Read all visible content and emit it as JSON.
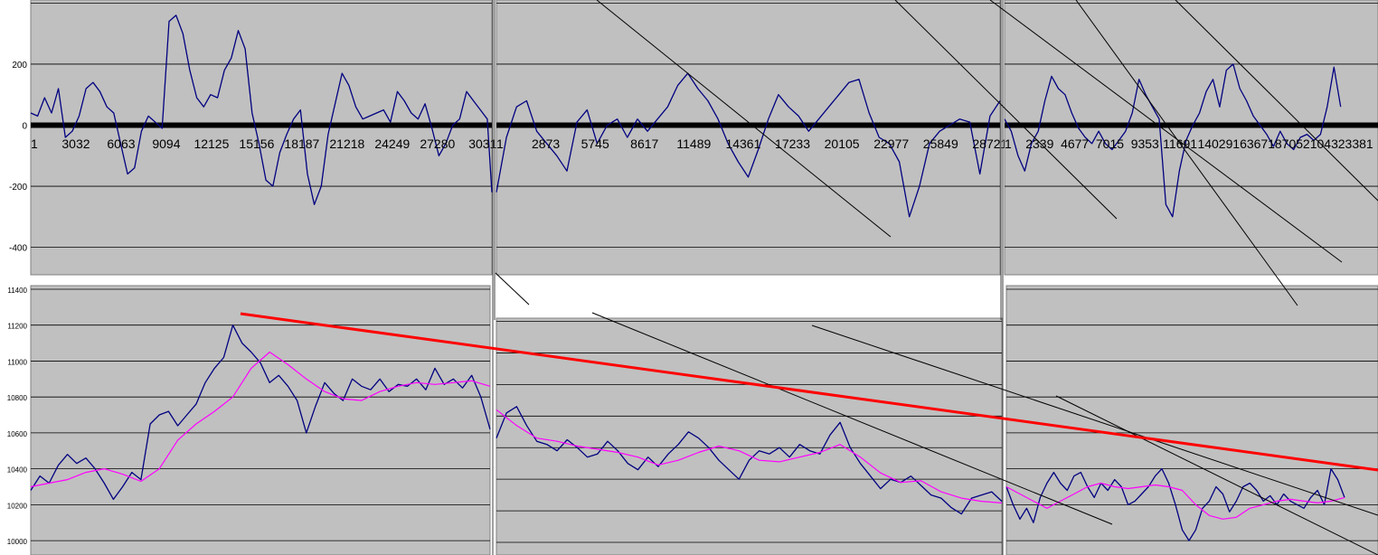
{
  "chart_data": [
    {
      "type": "line",
      "panel": "top-left",
      "y_ticks": [
        200,
        0,
        -200,
        -400
      ],
      "x_ticks": [
        "1",
        "3032",
        "6063",
        "9094",
        "12125",
        "15156",
        "18187",
        "21218",
        "24249",
        "27280",
        "3031"
      ],
      "ylim": [
        -490,
        410
      ],
      "series": [
        {
          "color": "#000080",
          "x": [
            0,
            1.5,
            3,
            4.5,
            6,
            7.5,
            9,
            10.5,
            12,
            13.5,
            15,
            16.5,
            18,
            19.5,
            21,
            22.5,
            24,
            25.5,
            27,
            28.5,
            30,
            31.5,
            33,
            34.5,
            36,
            37.5,
            39,
            40.5,
            42,
            43.5,
            45,
            46.5,
            48,
            49.5,
            51,
            52.5,
            54,
            55.5,
            57,
            58.5,
            60,
            61.5,
            63,
            64.5,
            66,
            67.5,
            69,
            70.5,
            72,
            73.5,
            75,
            76.5,
            78,
            79.5,
            81,
            82.5,
            84,
            85.5,
            87,
            88.5,
            90,
            91.5,
            93,
            94.5,
            96,
            97.5,
            99,
            100
          ],
          "y": [
            40,
            30,
            90,
            40,
            120,
            -40,
            -20,
            30,
            120,
            140,
            110,
            60,
            40,
            -60,
            -160,
            -140,
            -20,
            30,
            10,
            -10,
            340,
            360,
            300,
            180,
            90,
            60,
            100,
            90,
            180,
            220,
            310,
            250,
            40,
            -60,
            -180,
            -200,
            -90,
            -30,
            20,
            50,
            -160,
            -260,
            -200,
            -30,
            70,
            170,
            130,
            60,
            20,
            30,
            40,
            50,
            10,
            110,
            80,
            40,
            20,
            70,
            -10,
            -100,
            -60,
            0,
            20,
            110,
            80,
            50,
            20,
            -220
          ]
        }
      ]
    },
    {
      "type": "line",
      "panel": "top-middle",
      "y_ticks": [],
      "x_ticks": [
        "1",
        "2873",
        "5745",
        "8617",
        "11489",
        "14361",
        "17233",
        "20105",
        "22977",
        "25849",
        "28721"
      ],
      "ylim": [
        -490,
        410
      ],
      "series": [
        {
          "color": "#000080",
          "x": [
            0,
            2,
            4,
            6,
            8,
            10,
            12,
            14,
            16,
            18,
            20,
            22,
            24,
            26,
            28,
            30,
            32,
            34,
            36,
            38,
            40,
            42,
            44,
            46,
            48,
            50,
            52,
            54,
            56,
            58,
            60,
            62,
            64,
            66,
            68,
            70,
            72,
            74,
            76,
            78,
            80,
            82,
            84,
            86,
            88,
            90,
            92,
            94,
            96,
            98,
            100
          ],
          "y": [
            -220,
            -40,
            60,
            80,
            -20,
            -60,
            -100,
            -150,
            10,
            50,
            -60,
            0,
            20,
            -40,
            20,
            -20,
            20,
            60,
            130,
            170,
            120,
            80,
            20,
            -60,
            -120,
            -170,
            -80,
            20,
            100,
            60,
            30,
            -20,
            20,
            60,
            100,
            140,
            150,
            40,
            -40,
            -60,
            -120,
            -300,
            -200,
            -60,
            -20,
            0,
            20,
            10,
            -160,
            30,
            80
          ]
        }
      ]
    },
    {
      "type": "line",
      "panel": "top-right",
      "y_ticks": [],
      "x_ticks": [
        "1",
        "2339",
        "4677",
        "7015",
        "9353",
        "11691",
        "14029",
        "16367",
        "18705",
        "21043",
        "23381"
      ],
      "ylim": [
        -490,
        410
      ],
      "series": [
        {
          "color": "#000080",
          "x": [
            0,
            2,
            4,
            6,
            8,
            10,
            12,
            14,
            16,
            18,
            20,
            22,
            24,
            26,
            28,
            30,
            32,
            34,
            36,
            38,
            40,
            42,
            44,
            46,
            48,
            50,
            52,
            54,
            56,
            58,
            60,
            62,
            64,
            66,
            68,
            70,
            72,
            74,
            76,
            78,
            80,
            82,
            84,
            86,
            88,
            90,
            92,
            94,
            96,
            98,
            100
          ],
          "y": [
            20,
            -20,
            -100,
            -150,
            -60,
            -20,
            80,
            160,
            120,
            100,
            40,
            -10,
            -40,
            -60,
            -20,
            -60,
            -80,
            -50,
            -20,
            40,
            150,
            100,
            60,
            20,
            -260,
            -300,
            -150,
            -50,
            0,
            40,
            110,
            150,
            60,
            180,
            200,
            120,
            80,
            30,
            0,
            -30,
            -70,
            -20,
            -60,
            -80,
            -40,
            -30,
            -50,
            -30,
            60,
            190,
            60
          ]
        }
      ]
    },
    {
      "type": "line",
      "panel": "bottom-left",
      "y_ticks": [
        11400,
        11200,
        11000,
        10800,
        10600,
        10400,
        10200,
        10000
      ],
      "x_ticks": [],
      "ylim": [
        9920,
        11420
      ],
      "series": [
        {
          "color": "#000080",
          "x": [
            0,
            2,
            4,
            6,
            8,
            10,
            12,
            14,
            16,
            18,
            20,
            22,
            24,
            26,
            28,
            30,
            32,
            34,
            36,
            38,
            40,
            42,
            44,
            46,
            48,
            50,
            52,
            54,
            56,
            58,
            60,
            62,
            64,
            66,
            68,
            70,
            72,
            74,
            76,
            78,
            80,
            82,
            84,
            86,
            88,
            90,
            92,
            94,
            96,
            98,
            100
          ],
          "y": [
            10280,
            10360,
            10320,
            10420,
            10480,
            10430,
            10460,
            10400,
            10320,
            10230,
            10300,
            10380,
            10340,
            10650,
            10700,
            10720,
            10640,
            10700,
            10760,
            10880,
            10960,
            11020,
            11200,
            11100,
            11050,
            10990,
            10880,
            10920,
            10860,
            10780,
            10600,
            10750,
            10880,
            10820,
            10780,
            10900,
            10860,
            10840,
            10900,
            10830,
            10870,
            10860,
            10900,
            10840,
            10960,
            10870,
            10900,
            10850,
            10920,
            10800,
            10620
          ]
        },
        {
          "color": "#ff00ff",
          "x": [
            0,
            4,
            8,
            12,
            16,
            20,
            24,
            28,
            32,
            36,
            40,
            44,
            48,
            52,
            56,
            60,
            64,
            68,
            72,
            76,
            80,
            84,
            88,
            92,
            96,
            100
          ],
          "y": [
            10300,
            10320,
            10340,
            10380,
            10400,
            10370,
            10330,
            10400,
            10560,
            10650,
            10720,
            10800,
            10960,
            11050,
            10980,
            10900,
            10830,
            10790,
            10780,
            10830,
            10860,
            10880,
            10870,
            10880,
            10890,
            10860
          ]
        }
      ]
    },
    {
      "type": "line",
      "panel": "bottom-middle",
      "y_ticks": [],
      "x_ticks": [],
      "ylim": [
        9920,
        11420
      ],
      "series": [
        {
          "color": "#000080",
          "x": [
            0,
            2,
            4,
            6,
            8,
            10,
            12,
            14,
            16,
            18,
            20,
            22,
            24,
            26,
            28,
            30,
            32,
            34,
            36,
            38,
            40,
            42,
            44,
            46,
            48,
            50,
            52,
            54,
            56,
            58,
            60,
            62,
            64,
            66,
            68,
            70,
            72,
            74,
            76,
            78,
            80,
            82,
            84,
            86,
            88,
            90,
            92,
            94,
            96,
            98,
            100
          ],
          "y": [
            10660,
            10820,
            10860,
            10740,
            10640,
            10620,
            10580,
            10650,
            10600,
            10540,
            10560,
            10640,
            10580,
            10500,
            10460,
            10540,
            10480,
            10560,
            10620,
            10700,
            10660,
            10600,
            10520,
            10460,
            10400,
            10520,
            10580,
            10560,
            10600,
            10540,
            10620,
            10580,
            10560,
            10680,
            10760,
            10600,
            10500,
            10420,
            10340,
            10400,
            10380,
            10420,
            10360,
            10300,
            10280,
            10220,
            10180,
            10280,
            10300,
            10320,
            10260
          ]
        },
        {
          "color": "#ff00ff",
          "x": [
            0,
            4,
            8,
            12,
            16,
            20,
            24,
            28,
            32,
            36,
            40,
            44,
            48,
            52,
            56,
            60,
            64,
            68,
            72,
            76,
            80,
            84,
            88,
            92,
            96,
            100
          ],
          "y": [
            10840,
            10740,
            10660,
            10640,
            10610,
            10590,
            10570,
            10540,
            10490,
            10520,
            10570,
            10610,
            10580,
            10520,
            10510,
            10540,
            10570,
            10620,
            10540,
            10440,
            10380,
            10390,
            10320,
            10280,
            10260,
            10250
          ]
        }
      ]
    },
    {
      "type": "line",
      "panel": "bottom-right",
      "y_ticks": [],
      "x_ticks": [],
      "ylim": [
        9920,
        11420
      ],
      "series": [
        {
          "color": "#000080",
          "x": [
            0,
            2,
            4,
            6,
            8,
            10,
            12,
            14,
            16,
            18,
            20,
            22,
            24,
            26,
            28,
            30,
            32,
            34,
            36,
            38,
            40,
            42,
            44,
            46,
            48,
            50,
            52,
            54,
            56,
            58,
            60,
            62,
            64,
            66,
            68,
            70,
            72,
            74,
            76,
            78,
            80,
            82,
            84,
            86,
            88,
            90,
            92,
            94,
            96,
            98,
            100
          ],
          "y": [
            10300,
            10200,
            10120,
            10180,
            10100,
            10240,
            10320,
            10380,
            10320,
            10280,
            10360,
            10380,
            10300,
            10240,
            10320,
            10280,
            10340,
            10300,
            10200,
            10220,
            10260,
            10300,
            10360,
            10400,
            10320,
            10200,
            10060,
            10000,
            10060,
            10180,
            10220,
            10300,
            10260,
            10160,
            10220,
            10300,
            10320,
            10280,
            10220,
            10250,
            10200,
            10260,
            10220,
            10200,
            10180,
            10240,
            10280,
            10200,
            10400,
            10340,
            10240
          ]
        },
        {
          "color": "#ff00ff",
          "x": [
            0,
            4,
            8,
            12,
            16,
            20,
            24,
            28,
            32,
            36,
            40,
            44,
            48,
            52,
            56,
            60,
            64,
            68,
            72,
            76,
            80,
            84,
            88,
            92,
            96,
            100
          ],
          "y": [
            10300,
            10260,
            10220,
            10180,
            10220,
            10260,
            10300,
            10320,
            10300,
            10290,
            10300,
            10310,
            10300,
            10280,
            10200,
            10140,
            10120,
            10130,
            10180,
            10200,
            10220,
            10230,
            10220,
            10210,
            10220,
            10240
          ]
        }
      ]
    }
  ],
  "colors": {
    "plot_area": "#c0c0c0",
    "series_line": "#000080",
    "moving_average": "#ff00ff",
    "trend_line": "#ff0000",
    "channel_lines": "#000000"
  }
}
